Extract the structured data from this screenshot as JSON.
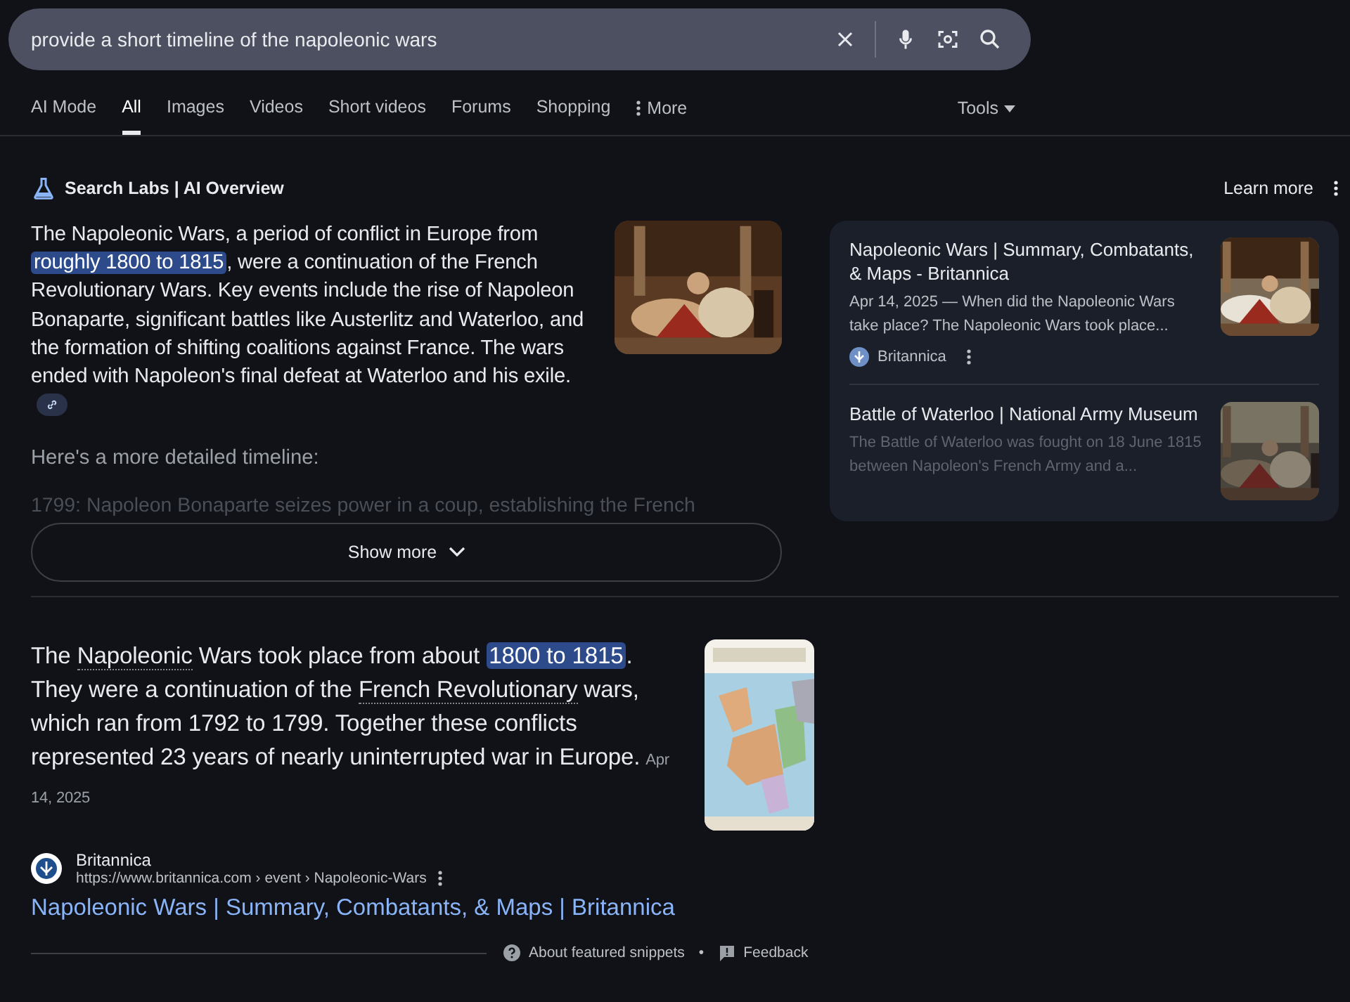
{
  "search": {
    "value": "provide a short timeline of the napoleonic wars"
  },
  "tabs": [
    {
      "label": "AI Mode",
      "selected": false
    },
    {
      "label": "All",
      "selected": true
    },
    {
      "label": "Images",
      "selected": false
    },
    {
      "label": "Videos",
      "selected": false
    },
    {
      "label": "Short videos",
      "selected": false
    },
    {
      "label": "Forums",
      "selected": false
    },
    {
      "label": "Shopping",
      "selected": false
    }
  ],
  "more": "More",
  "tools": "Tools",
  "ai_overview": {
    "title": "Search Labs | AI Overview",
    "learn_more": "Learn more",
    "summary": [
      {
        "kind": "plain",
        "text": "The Napoleonic Wars, a period of conflict in Europe from "
      },
      {
        "kind": "highlight",
        "text": "roughly 1800 to 1815"
      },
      {
        "kind": "plain",
        "text": ", were a continuation of the French Revolutionary Wars. Key events include the rise of Napoleon Bonaparte, significant battles like Austerlitz and Waterloo, and the formation of shifting coalitions against France. The wars ended with Napoleon's final defeat at Waterloo and his exile."
      }
    ],
    "detail_intro": "Here's a more detailed timeline:",
    "faded_line": "1799: Napoleon Bonaparte seizes power in a coup, establishing the French",
    "show_more": "Show more",
    "sources": [
      {
        "title": "Napoleonic Wars | Summary, Combatants, & Maps - Britannica",
        "snippet": "Apr 14, 2025 — When did the Napoleonic Wars take place? The Napoleonic Wars took place...",
        "site": "Britannica",
        "faded": false
      },
      {
        "title": "Battle of Waterloo | National Army Museum",
        "snippet": "The Battle of Waterloo was fought on 18 June 1815 between Napoleon's French Army and a...",
        "faded": true
      }
    ]
  },
  "featured_snippet": {
    "text": [
      {
        "kind": "plain",
        "text": "The "
      },
      {
        "kind": "underlined",
        "text": "Napoleonic"
      },
      {
        "kind": "plain",
        "text": " Wars took place from about "
      },
      {
        "kind": "highlight",
        "text": "1800 to 1815"
      },
      {
        "kind": "plain",
        "text": ". They were a continuation of the "
      },
      {
        "kind": "underlined",
        "text": "French Revolutionary"
      },
      {
        "kind": "plain",
        "text": " wars, which ran from 1792 to 1799. Together these conflicts represented 23 years of nearly uninterrupted war in Europe."
      }
    ],
    "date": "Apr 14, 2025",
    "site": "Britannica",
    "url": "https://www.britannica.com › event › Napoleonic-Wars",
    "link": "Napoleonic Wars | Summary, Combatants, & Maps | Britannica",
    "about": "About featured snippets",
    "separator": "•",
    "feedback": "Feedback"
  }
}
